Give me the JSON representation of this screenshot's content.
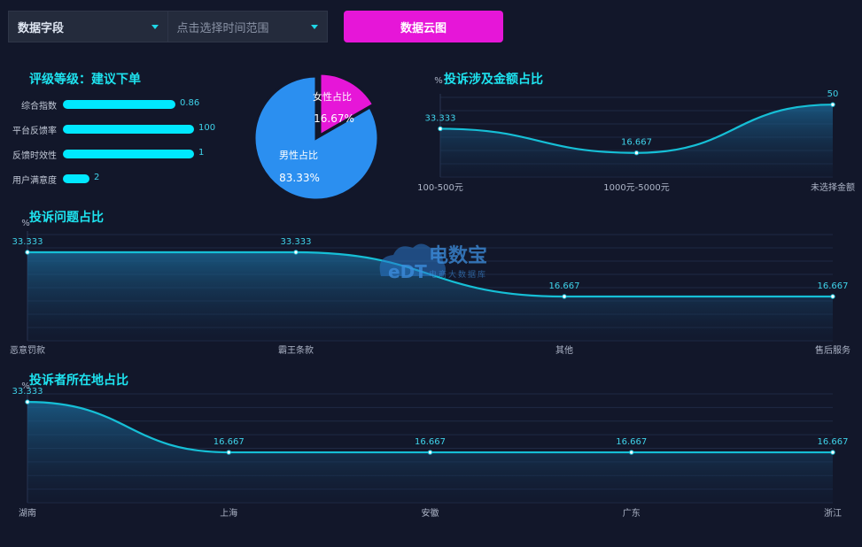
{
  "controls": {
    "field_select": "数据字段",
    "time_placeholder": "点击选择时间范围",
    "cloud_button": "数据云图"
  },
  "rating": {
    "title": "评级等级：建议下单",
    "items": [
      {
        "label": "综合指数",
        "value": "0.86",
        "fraction": 0.86
      },
      {
        "label": "平台反馈率",
        "value": "100",
        "fraction": 1.0
      },
      {
        "label": "反馈时效性",
        "value": "1",
        "fraction": 1.0
      },
      {
        "label": "用户满意度",
        "value": "2",
        "fraction": 0.2
      }
    ]
  },
  "watermark": {
    "brand": "电数宝",
    "sub": "电商大数据库",
    "logo": "eDT"
  },
  "colors": {
    "accent": "#1ee3ef",
    "pink": "#e616d8",
    "blue": "#2b8ff0",
    "line": "#16bfd6"
  },
  "chart_data": [
    {
      "type": "pie",
      "title": "",
      "slices": [
        {
          "name": "女性占比",
          "value": 16.67,
          "label": "16.67%"
        },
        {
          "name": "男性占比",
          "value": 83.33,
          "label": "83.33%"
        }
      ]
    },
    {
      "type": "area",
      "title": "投诉涉及金额占比",
      "ylabel": "%",
      "categories": [
        "100-500元",
        "1000元-5000元",
        "未选择金额"
      ],
      "values": [
        33.333,
        16.667,
        50
      ],
      "value_labels": [
        "33.333",
        "16.667",
        "50"
      ],
      "ylim": [
        0,
        55
      ]
    },
    {
      "type": "area",
      "title": "投诉问题占比",
      "ylabel": "%",
      "categories": [
        "恶意罚款",
        "霸王条款",
        "其他",
        "售后服务"
      ],
      "values": [
        33.333,
        33.333,
        16.667,
        16.667
      ],
      "value_labels": [
        "33.333",
        "33.333",
        "16.667",
        "16.667"
      ],
      "ylim": [
        0,
        40
      ]
    },
    {
      "type": "area",
      "title": "投诉者所在地占比",
      "ylabel": "%",
      "categories": [
        "湖南",
        "上海",
        "安徽",
        "广东",
        "浙江"
      ],
      "values": [
        33.333,
        16.667,
        16.667,
        16.667,
        16.667
      ],
      "value_labels": [
        "33.333",
        "16.667",
        "16.667",
        "16.667",
        "16.667"
      ],
      "ylim": [
        0,
        36
      ]
    }
  ]
}
